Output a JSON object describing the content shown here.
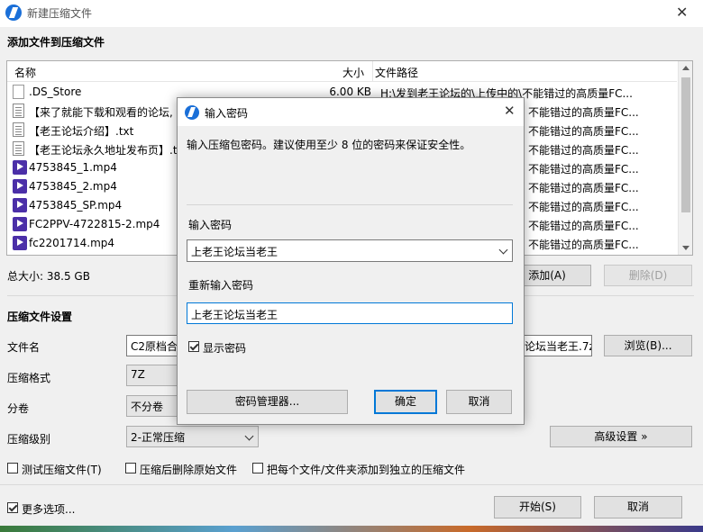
{
  "window": {
    "title": "新建压缩文件",
    "close_glyph": "✕"
  },
  "files_section": {
    "heading": "添加文件到压缩文件",
    "columns": {
      "name": "名称",
      "size": "大小",
      "path": "文件路径"
    },
    "rows": [
      {
        "icon": "file-icon",
        "name": ".DS_Store",
        "size": "6.00 KB",
        "path": "H:\\发到老王论坛的\\上传中的\\不能错过的高质量FC..."
      },
      {
        "icon": "text-file-icon",
        "name": "【来了就能下载和观看的论坛,",
        "size": "",
        "path": "不能错过的高质量FC..."
      },
      {
        "icon": "text-file-icon",
        "name": "【老王论坛介绍】.txt",
        "size": "",
        "path": "不能错过的高质量FC..."
      },
      {
        "icon": "text-file-icon",
        "name": "【老王论坛永久地址发布页】.tx",
        "size": "",
        "path": "不能错过的高质量FC..."
      },
      {
        "icon": "video-file-icon",
        "name": "4753845_1.mp4",
        "size": "",
        "path": "不能错过的高质量FC..."
      },
      {
        "icon": "video-file-icon",
        "name": "4753845_2.mp4",
        "size": "",
        "path": "不能错过的高质量FC..."
      },
      {
        "icon": "video-file-icon",
        "name": "4753845_SP.mp4",
        "size": "",
        "path": "不能错过的高质量FC..."
      },
      {
        "icon": "video-file-icon",
        "name": "FC2PPV-4722815-2.mp4",
        "size": "",
        "path": "不能错过的高质量FC..."
      },
      {
        "icon": "video-file-icon",
        "name": "fc2201714.mp4",
        "size": "",
        "path": "不能错过的高质量FC..."
      }
    ],
    "total_size": "总大小: 38.5 GB",
    "add_button": "添加(A)",
    "remove_button": "删除(D)"
  },
  "settings": {
    "heading": "压缩文件设置",
    "filename_label": "文件名",
    "filename_value": "C2原档合",
    "filename_tail": "论坛当老王.7z",
    "browse_button": "浏览(B)...",
    "format_label": "压缩格式",
    "format_value": "7Z",
    "split_label": "分卷",
    "split_value": "不分卷",
    "level_label": "压缩级别",
    "level_value": "2-正常压缩",
    "advanced_button": "高级设置 »",
    "test_check": "测试压缩文件(T)",
    "delete_check": "压缩后删除原始文件",
    "separate_check": "把每个文件/文件夹添加到独立的压缩文件",
    "more_options": "更多选项...",
    "start_button": "开始(S)",
    "cancel_button": "取消"
  },
  "dialog": {
    "title": "输入密码",
    "close_glyph": "✕",
    "hint": "输入压缩包密码。建议使用至少 8 位的密码来保证安全性。",
    "password_label": "输入密码",
    "password_value": "上老王论坛当老王",
    "reenter_label": "重新输入密码",
    "reenter_value": "上老王论坛当老王",
    "show_password": "显示密码",
    "show_password_checked": true,
    "manager_button": "密码管理器...",
    "ok_button": "确定",
    "cancel_button": "取消"
  }
}
